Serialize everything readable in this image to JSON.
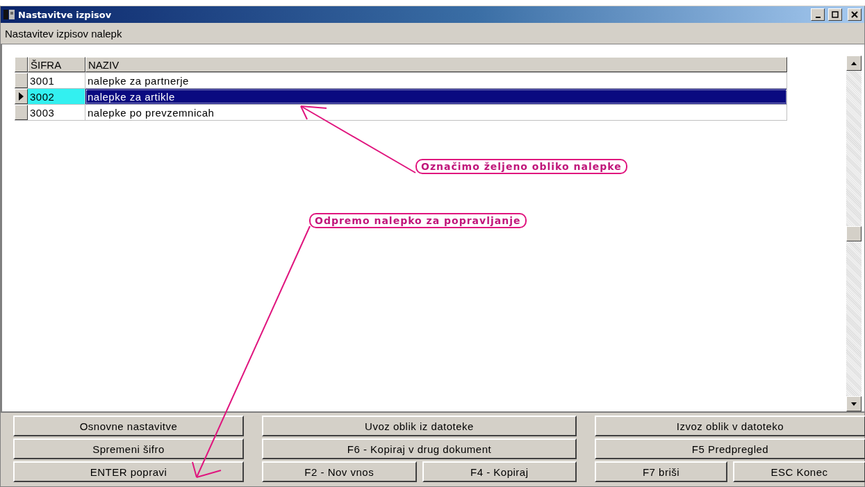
{
  "window": {
    "title": "Nastavitve izpisov"
  },
  "subtitle": "Nastavitev izpisov nalepk",
  "table": {
    "columns": [
      "ŠIFRA",
      "NAZIV"
    ],
    "rows": [
      {
        "code": "3001",
        "name": "nalepke za partnerje",
        "selected": false
      },
      {
        "code": "3002",
        "name": "nalepke za artikle",
        "selected": true
      },
      {
        "code": "3003",
        "name": "nalepke po prevzemnicah",
        "selected": false
      }
    ]
  },
  "annotations": [
    "Označimo željeno obliko nalepke",
    "Odpremo nalepko za popravljanje"
  ],
  "button_rows": [
    [
      [
        "Osnovne nastavitve"
      ],
      [
        "Uvoz oblik iz datoteke"
      ],
      [
        "Izvoz oblik v datoteko"
      ]
    ],
    [
      [
        "Spremeni šifro"
      ],
      [
        "F6 - Kopiraj v drug dokument"
      ],
      [
        "F5 Predpregled"
      ]
    ],
    [
      [
        "ENTER popravi"
      ],
      [
        "F2 - Nov vnos",
        "F4 - Kopiraj"
      ],
      [
        "F7 briši",
        "ESC Konec"
      ]
    ]
  ]
}
